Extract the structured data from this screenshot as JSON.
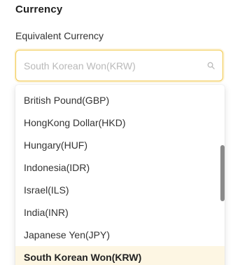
{
  "section": {
    "title": "Currency"
  },
  "field": {
    "label": "Equivalent Currency",
    "placeholder": "South Korean Won(KRW)"
  },
  "dropdown": {
    "options": [
      "British Pound(GBP)",
      "HongKong Dollar(HKD)",
      "Hungary(HUF)",
      "Indonesia(IDR)",
      "Israel(ILS)",
      "India(INR)",
      "Japanese Yen(JPY)",
      "South Korean Won(KRW)"
    ],
    "selected": "South Korean Won(KRW)"
  },
  "colors": {
    "focus_border": "#f2c94c",
    "selected_background": "#fdf6e3"
  },
  "icons": {
    "field_icon": "search-icon"
  }
}
